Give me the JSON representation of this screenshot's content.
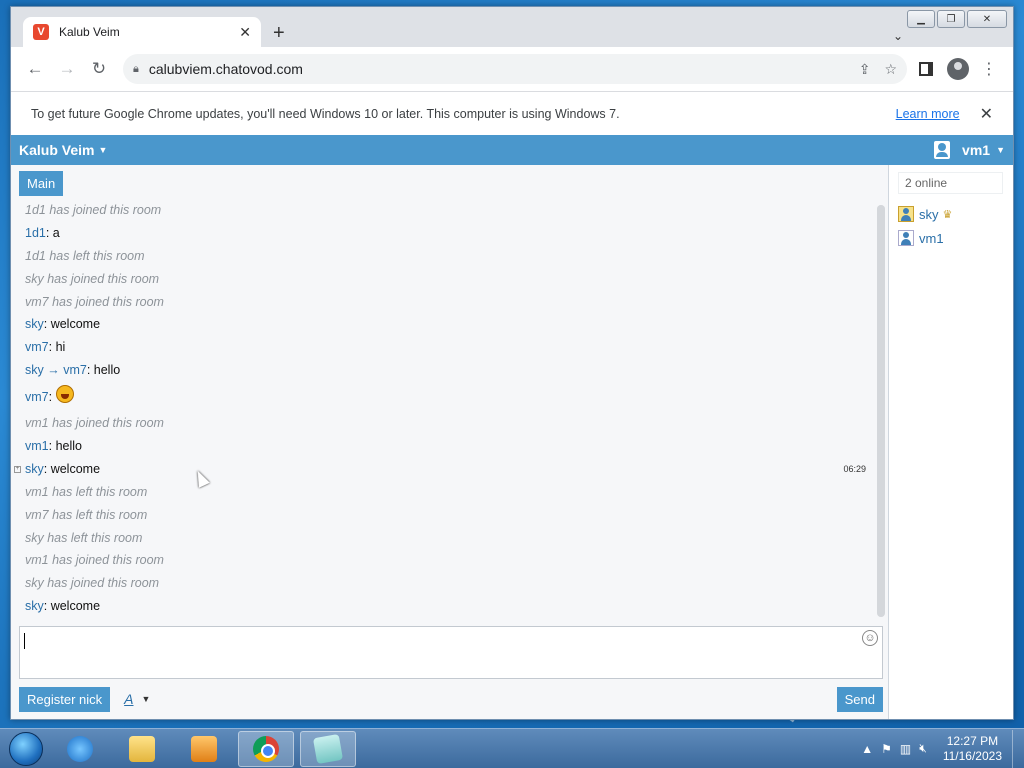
{
  "browser": {
    "tab_title": "Kalub Veim",
    "favicon_letter": "V",
    "new_tab_label": "+",
    "url": "calubviem.chatovod.com",
    "infobar_text": "To get future Google Chrome updates, you'll need Windows 10 or later. This computer is using Windows 7.",
    "learn_more": "Learn more"
  },
  "chat": {
    "site_name": "Kalub Veim",
    "username": "vm1",
    "room_tab": "Main",
    "messages": [
      {
        "type": "sys",
        "text": "1d1 has joined this room"
      },
      {
        "type": "msg",
        "nick": "1d1",
        "text": "a"
      },
      {
        "type": "sys",
        "text": "1d1 has left this room"
      },
      {
        "type": "sys",
        "text": "sky has joined this room"
      },
      {
        "type": "sys",
        "text": "vm7 has joined this room"
      },
      {
        "type": "msg",
        "nick": "sky",
        "text": "welcome"
      },
      {
        "type": "msg",
        "nick": "vm7",
        "text": "hi"
      },
      {
        "type": "pm",
        "nick": "sky",
        "to": "vm7",
        "text": "hello"
      },
      {
        "type": "smiley",
        "nick": "vm7"
      },
      {
        "type": "sys",
        "text": "vm1 has joined this room"
      },
      {
        "type": "msg",
        "nick": "vm1",
        "text": "hello"
      },
      {
        "type": "msg",
        "nick": "sky",
        "text": "welcome",
        "time": "06:29"
      },
      {
        "type": "sys",
        "text": "vm1 has left this room"
      },
      {
        "type": "sys",
        "text": "vm7 has left this room"
      },
      {
        "type": "sys",
        "text": "sky has left this room"
      },
      {
        "type": "sys",
        "text": "vm1 has joined this room"
      },
      {
        "type": "sys",
        "text": "sky has joined this room"
      },
      {
        "type": "msg",
        "nick": "sky",
        "text": "welcome"
      }
    ],
    "register_label": "Register nick",
    "font_label": "A",
    "send_label": "Send",
    "online_count": "2 online",
    "users": [
      {
        "name": "sky",
        "role": "crown"
      },
      {
        "name": "vm1",
        "role": ""
      }
    ]
  },
  "taskbar": {
    "time": "12:27 PM",
    "date": "11/16/2023",
    "apps": [
      "ie-icon",
      "explorer-icon",
      "media-player-icon",
      "chrome-icon",
      "notepad-icon"
    ]
  },
  "colors": {
    "chat_accent": "#4a97cc",
    "nick": "#2a6fa8",
    "system_text": "#8d9399"
  }
}
